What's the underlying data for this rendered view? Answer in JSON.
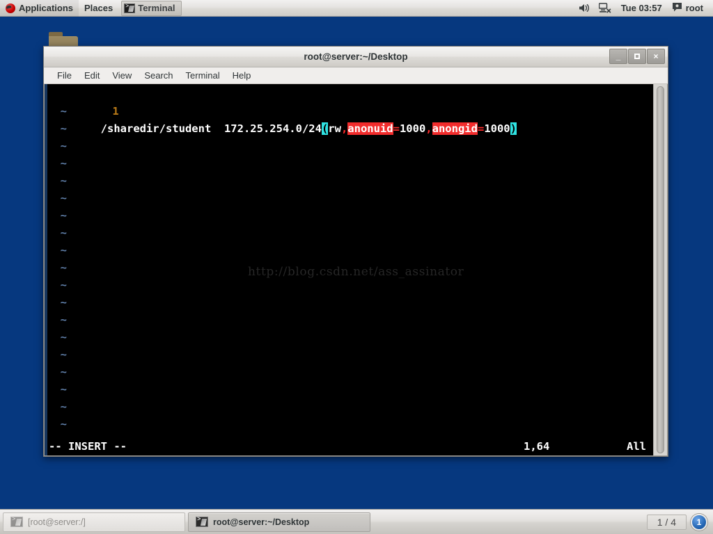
{
  "desktop": {
    "background_color": "#06387f",
    "folder_icon_name": "folder-icon"
  },
  "top_panel": {
    "applications_label": "Applications",
    "places_label": "Places",
    "window_task_label": "Terminal",
    "volume_icon": "speaker-icon",
    "network_icon": "network-disconnected-icon",
    "clock": "Tue 03:57",
    "user_icon": "user-icon",
    "user_label": "root"
  },
  "window": {
    "title": "root@server:~/Desktop",
    "controls": {
      "minimize": "_",
      "maximize": "",
      "close": "×"
    },
    "menubar": [
      "File",
      "Edit",
      "View",
      "Search",
      "Terminal",
      "Help"
    ]
  },
  "editor": {
    "line_number": "1",
    "segments": [
      {
        "text": "/sharedir/student  172.25.254.0/24",
        "style": "white"
      },
      {
        "text": "(",
        "style": "paren"
      },
      {
        "text": "rw",
        "style": "white"
      },
      {
        "text": ",",
        "style": "red"
      },
      {
        "text": "anonuid",
        "style": "redbg"
      },
      {
        "text": "=",
        "style": "red"
      },
      {
        "text": "1000",
        "style": "white"
      },
      {
        "text": ",",
        "style": "red"
      },
      {
        "text": "anongid",
        "style": "redbg"
      },
      {
        "text": "=",
        "style": "red"
      },
      {
        "text": "1000",
        "style": "white"
      },
      {
        "text": ")",
        "style": "paren"
      }
    ],
    "tilde_char": "~",
    "tilde_count": 20,
    "watermark": "http://blog.csdn.net/ass_assinator",
    "status": {
      "mode": "-- INSERT --",
      "position": "1,64",
      "scroll": "All"
    }
  },
  "bottom_panel": {
    "tasks": [
      {
        "label": "[root@server:/]",
        "active": false
      },
      {
        "label": "root@server:~/Desktop",
        "active": true
      }
    ],
    "workspace": "1 / 4",
    "notification_count": "1"
  }
}
